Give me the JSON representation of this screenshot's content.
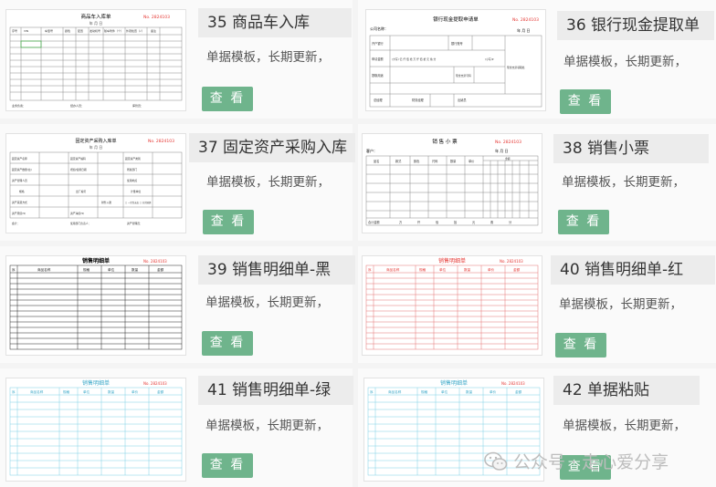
{
  "cards": [
    {
      "id": "35",
      "title": "35 商品车入库",
      "desc": "单据模板，长期更新，",
      "button": "查 看",
      "doc": {
        "title": "商品车入库单",
        "no": "No. 2824103",
        "date": "年 月 日",
        "headers": [
          "序号",
          "VIN",
          "车型号",
          "颜色",
          "配置",
          "发动机号",
          "随车附件（个）",
          "外观检查（√）",
          "备注"
        ],
        "footer": [
          "业务负责：",
          "经办人员：",
          "库管员："
        ]
      }
    },
    {
      "id": "36",
      "title": "36 银行现金提取单",
      "desc": "单据模板，长期更新，",
      "button": "查 看",
      "doc": {
        "title": "银行现金提取申请单",
        "no": "No. 2824103",
        "company": "公司名称：",
        "date": "年 月 日",
        "row1": [
          "开户银行",
          "",
          "银行账号"
        ],
        "row2": [
          "申请金额",
          "(大写)  亿  仟  佰  拾  万  仟  佰  拾  元  角  分",
          "(小写)¥"
        ],
        "row3": [
          "提取用途",
          "",
          "现金支票号码"
        ],
        "side": "现金支票领取处",
        "row4": [
          "总经理",
          "财务经理",
          "出纳员"
        ]
      }
    },
    {
      "id": "37",
      "title": "37 固定资产采购入库",
      "desc": "单据模板，长期更新，",
      "button": "查 看",
      "doc": {
        "title": "固定资产采购入库单",
        "no": "No. 2824103",
        "date": "年 月 日",
        "rows": [
          [
            "固定资产名称",
            "",
            "固定资产编码",
            "",
            "固定资产类别",
            ""
          ],
          [
            "固定资产数量(台)",
            "",
            "增加/使用日期",
            "",
            "所属部门",
            ""
          ],
          [
            "资产管理人员",
            "",
            "",
            "",
            "使用地点",
            ""
          ],
          [
            "规格",
            "",
            "出厂编号",
            "",
            "计量单位",
            ""
          ],
          [
            "资产来源方式",
            "",
            "",
            "",
            "财务入账",
            "□ 一次性支出 □ 分次摊销"
          ],
          [
            "资产原值(¥)",
            "",
            "资产净值(¥)",
            "",
            "",
            ""
          ]
        ],
        "footer": [
          "会计：",
          "使用部门负责人：",
          "资产管理员："
        ]
      }
    },
    {
      "id": "38",
      "title": "38 销售小票",
      "desc": "单据模板，长期更新，",
      "button": "查 看",
      "doc": {
        "title": "销 售 小 票",
        "no": "No. 2824103",
        "customer": "客户：",
        "date": "年 月 日",
        "headers": [
          "品名",
          "款式",
          "颜色",
          "尺码",
          "数量",
          "单价",
          "金额"
        ],
        "amount": "金额",
        "total": "合计金额",
        "total_units": [
          "万",
          "仟",
          "佰",
          "拾",
          "元",
          "角",
          "分"
        ]
      }
    },
    {
      "id": "39",
      "title": "39 销售明细单-黑",
      "desc": "单据模板，长期更新，",
      "button": "查 看",
      "doc": {
        "title": "销售明细单",
        "no": "No. 2824103",
        "headers": [
          "序",
          "商品名称",
          "规格",
          "单位",
          "数量",
          "单价",
          "金额"
        ]
      }
    },
    {
      "id": "40",
      "title": "40 销售明细单-红",
      "desc": "单据模板，长期更新，",
      "button": "查 看",
      "doc": {
        "title": "销售明细单",
        "no": "No. 2824103",
        "headers": [
          "序",
          "商品名称",
          "规格",
          "单位",
          "数量",
          "单价",
          "金额"
        ]
      }
    },
    {
      "id": "41",
      "title": "41 销售明细单-绿",
      "desc": "单据模板，长期更新，",
      "button": "查 看",
      "doc": {
        "title": "销售明细单",
        "no": "No. 2824103",
        "headers": [
          "序",
          "商品名称",
          "规格",
          "单位",
          "数量",
          "单价",
          "金额"
        ]
      }
    },
    {
      "id": "42",
      "title": "42 单据粘贴",
      "desc": "单据模板，长期更新，",
      "button": "查 看",
      "doc": {
        "title": "销售明细单",
        "no": "No. 2824103",
        "headers": [
          "序",
          "商品名称",
          "规格",
          "单位",
          "数量",
          "单价",
          "金额"
        ]
      }
    }
  ],
  "watermark": {
    "text": "公众号 · 走心爱分享",
    "icon": "wechat-icon"
  },
  "colors": {
    "button": "#6fb48c",
    "title_bg": "#ececec",
    "red": "#e53935",
    "teal": "#3aa8c8"
  }
}
